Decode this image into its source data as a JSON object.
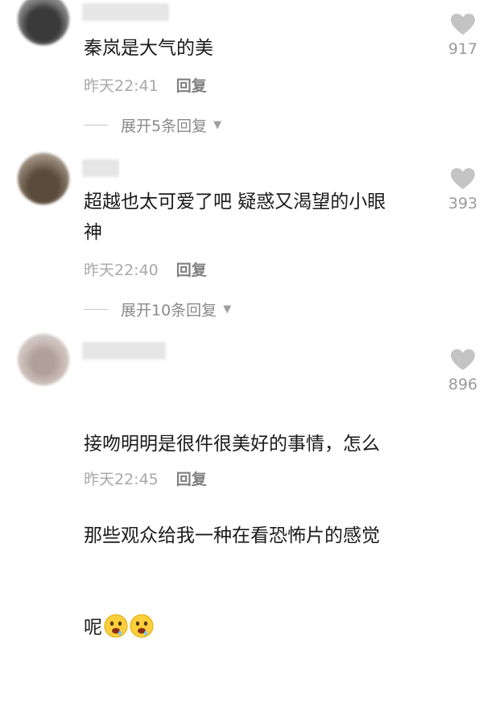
{
  "colors": {
    "text": "#1a1a1a",
    "meta": "#a8a8a8",
    "like_icon": "#c4c4c4",
    "count": "#9a9a9a"
  },
  "comments": [
    {
      "text": "秦岚是大气的美",
      "time": "昨天22:41",
      "reply_label": "回复",
      "expand_label": "展开5条回复",
      "likes": "917",
      "avatar": "blurred-avatar"
    },
    {
      "text": "超越也太可爱了吧 疑惑又渴望的小眼\n神",
      "time": "昨天22:40",
      "reply_label": "回复",
      "expand_label": "展开10条回复",
      "likes": "393",
      "avatar": "blurred-avatar"
    },
    {
      "text_line1": "接吻明明是很件很美好的事情，怎么",
      "text_line2": "那些观众给我一种在看恐怖片的感觉",
      "text_line3": "呢",
      "emojis": [
        "drooling-face-emoji",
        "drooling-face-emoji"
      ],
      "time": "昨天22:45",
      "reply_label": "回复",
      "likes": "896",
      "avatar": "blurred-avatar"
    }
  ]
}
